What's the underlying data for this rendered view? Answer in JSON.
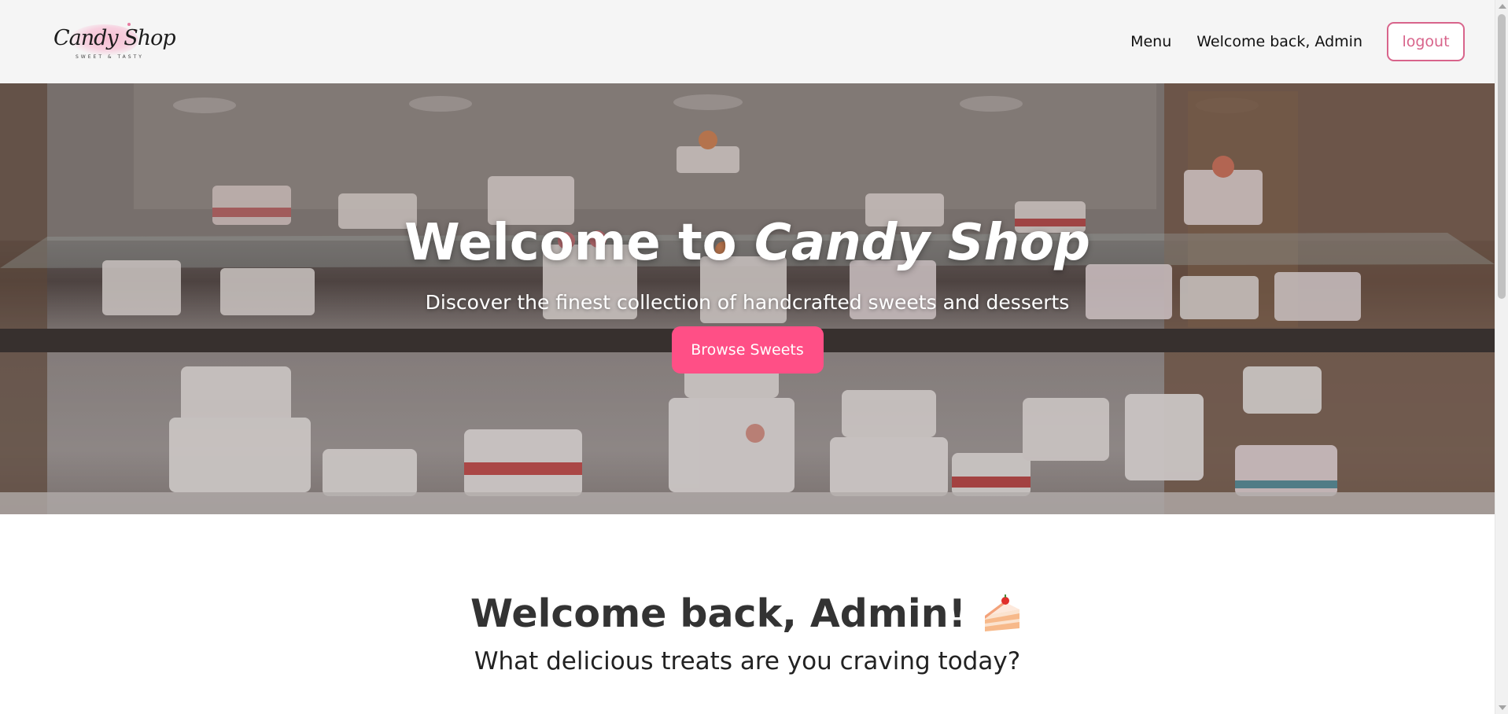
{
  "logo": {
    "name": "Candy Shop",
    "tagline": "SWEET & TASTY"
  },
  "nav": {
    "menu_label": "Menu",
    "welcome_text": "Welcome back, Admin",
    "logout_label": "logout"
  },
  "hero": {
    "title_prefix": "Welcome to",
    "title_brand": "Candy Shop",
    "subtitle": "Discover the finest collection of handcrafted sweets and desserts",
    "button_label": "Browse Sweets"
  },
  "welcome": {
    "title": "Welcome back, Admin!",
    "icon": "cake-icon",
    "subtitle": "What delicious treats are you craving today?"
  },
  "colors": {
    "accent": "#ff4f86",
    "logout_border": "#d8648b",
    "navbar_bg": "#f5f5f5"
  }
}
